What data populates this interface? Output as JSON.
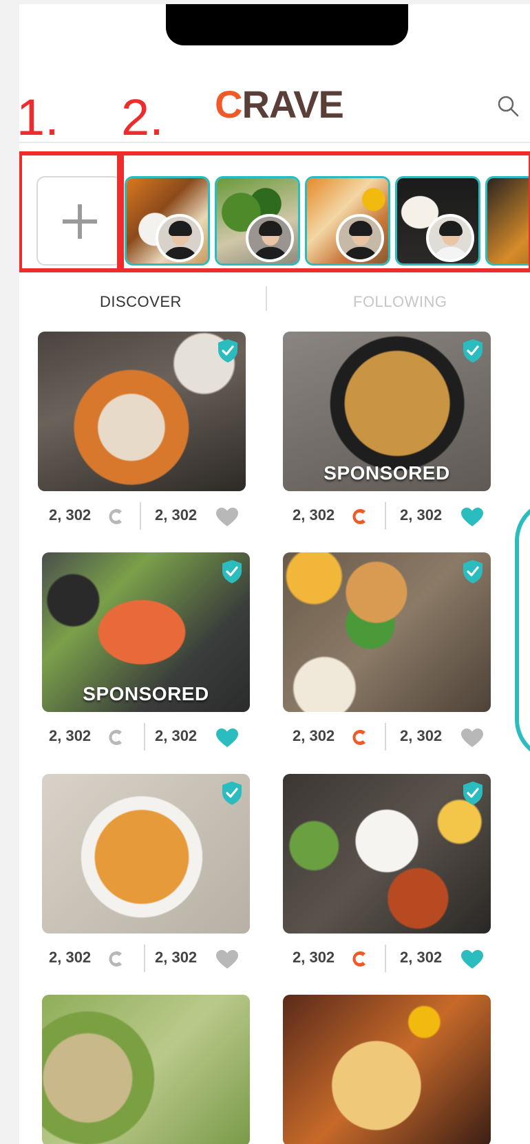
{
  "app": {
    "logo_c": "C",
    "logo_rest": "RAVE",
    "search_icon": "search-icon"
  },
  "annotations": {
    "label_1": "1.",
    "label_2": "2."
  },
  "tabs": {
    "discover": "DISCOVER",
    "following": "FOLLOWING",
    "active": "DISCOVER"
  },
  "colors": {
    "brand_orange": "#ef5a28",
    "brand_brown": "#5a3f38",
    "teal": "#2bbcbf",
    "annotation_red": "#ee2c2c",
    "inactive_gray": "#c6c6c6"
  },
  "feed": [
    {
      "crave_count": "2, 302",
      "like_count": "2, 302",
      "crave_active": false,
      "liked": false,
      "sponsored": false,
      "sponsored_label": ""
    },
    {
      "crave_count": "2, 302",
      "like_count": "2, 302",
      "crave_active": true,
      "liked": true,
      "sponsored": true,
      "sponsored_label": "SPONSORED"
    },
    {
      "crave_count": "2, 302",
      "like_count": "2, 302",
      "crave_active": false,
      "liked": true,
      "sponsored": true,
      "sponsored_label": "SPONSORED"
    },
    {
      "crave_count": "2, 302",
      "like_count": "2, 302",
      "crave_active": true,
      "liked": false,
      "sponsored": false,
      "sponsored_label": ""
    },
    {
      "crave_count": "2, 302",
      "like_count": "2, 302",
      "crave_active": false,
      "liked": false,
      "sponsored": false,
      "sponsored_label": ""
    },
    {
      "crave_count": "2, 302",
      "like_count": "2, 302",
      "crave_active": true,
      "liked": true,
      "sponsored": false,
      "sponsored_label": ""
    }
  ]
}
